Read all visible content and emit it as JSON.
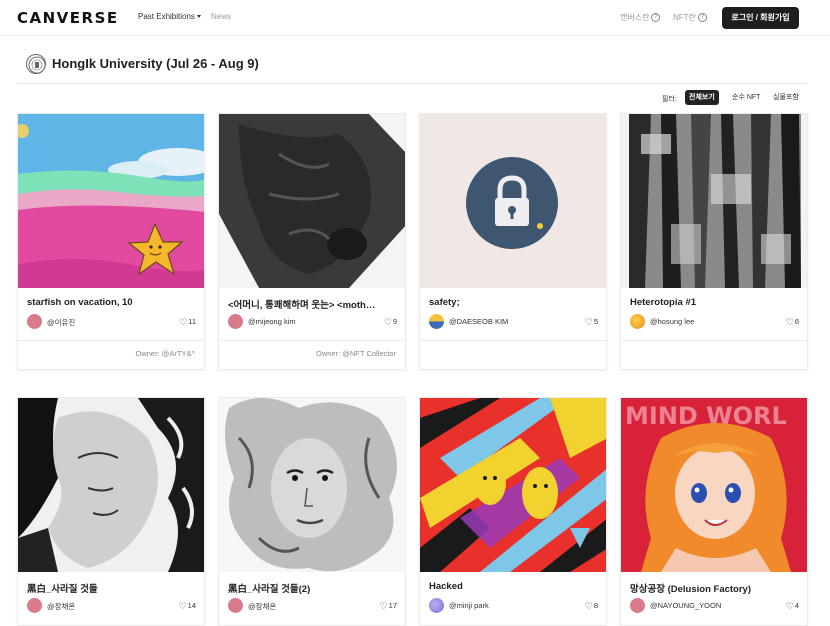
{
  "nav": {
    "logo": "CANVERSE",
    "past_exhibitions": "Past Exhibitions",
    "news": "News",
    "canvers_label": "캔버스란",
    "nft_label": "NFT란",
    "login": "로그인 / 회원가입"
  },
  "exhibition": {
    "title": "HongIk University (Jul 26 - Aug 9)"
  },
  "filter": {
    "label": "필터:",
    "options": [
      "전체보기",
      "순수 NFT",
      "실물포함"
    ],
    "selected": "전체보기"
  },
  "cards": [
    {
      "title": "starfish on vacation, 10",
      "author": "@이유진",
      "likes": "11",
      "owner_label": "Owner:",
      "owner": "@ArTY&^",
      "avatar_color": "#d97b8a"
    },
    {
      "title": "<어머니, 통쾌해하며 웃는> <moth…",
      "author": "@mijeong kim",
      "likes": "9",
      "owner_label": "Owner:",
      "owner": "@NFT Collector",
      "avatar_color": "#d97b8a"
    },
    {
      "title": "safety;",
      "author": "@DAESEOB KIM",
      "likes": "5",
      "owner_label": "",
      "owner": "",
      "avatar_color": "#e8b33a"
    },
    {
      "title": "Heterotopia #1",
      "author": "@hosung lee",
      "likes": "6",
      "owner_label": "",
      "owner": "",
      "avatar_color": "#f0a12e"
    },
    {
      "title": "黑白_사라질 것들",
      "author": "@장채온",
      "likes": "14",
      "avatar_color": "#d97b8a"
    },
    {
      "title": "黑白_사라질 것들(2)",
      "author": "@장채온",
      "likes": "17",
      "avatar_color": "#d97b8a"
    },
    {
      "title": "Hacked",
      "author": "@minji park",
      "likes": "8",
      "avatar_color": "#9a8fe0"
    },
    {
      "title": "망상공장 (Delusion Factory)",
      "author": "@NAYOUNG_YOON",
      "likes": "4",
      "avatar_color": "#d97b8a"
    }
  ],
  "artwork_text": {
    "nayoung_banner": "MIND WORL"
  },
  "icons": {
    "like": "heart-outline-icon",
    "help": "question-circle-icon",
    "dropdown": "caret-down-icon"
  },
  "colors": {
    "login_bg": "#1e1e1e",
    "filter_active_bg": "#222222",
    "lock_circle": "#3e5670"
  }
}
